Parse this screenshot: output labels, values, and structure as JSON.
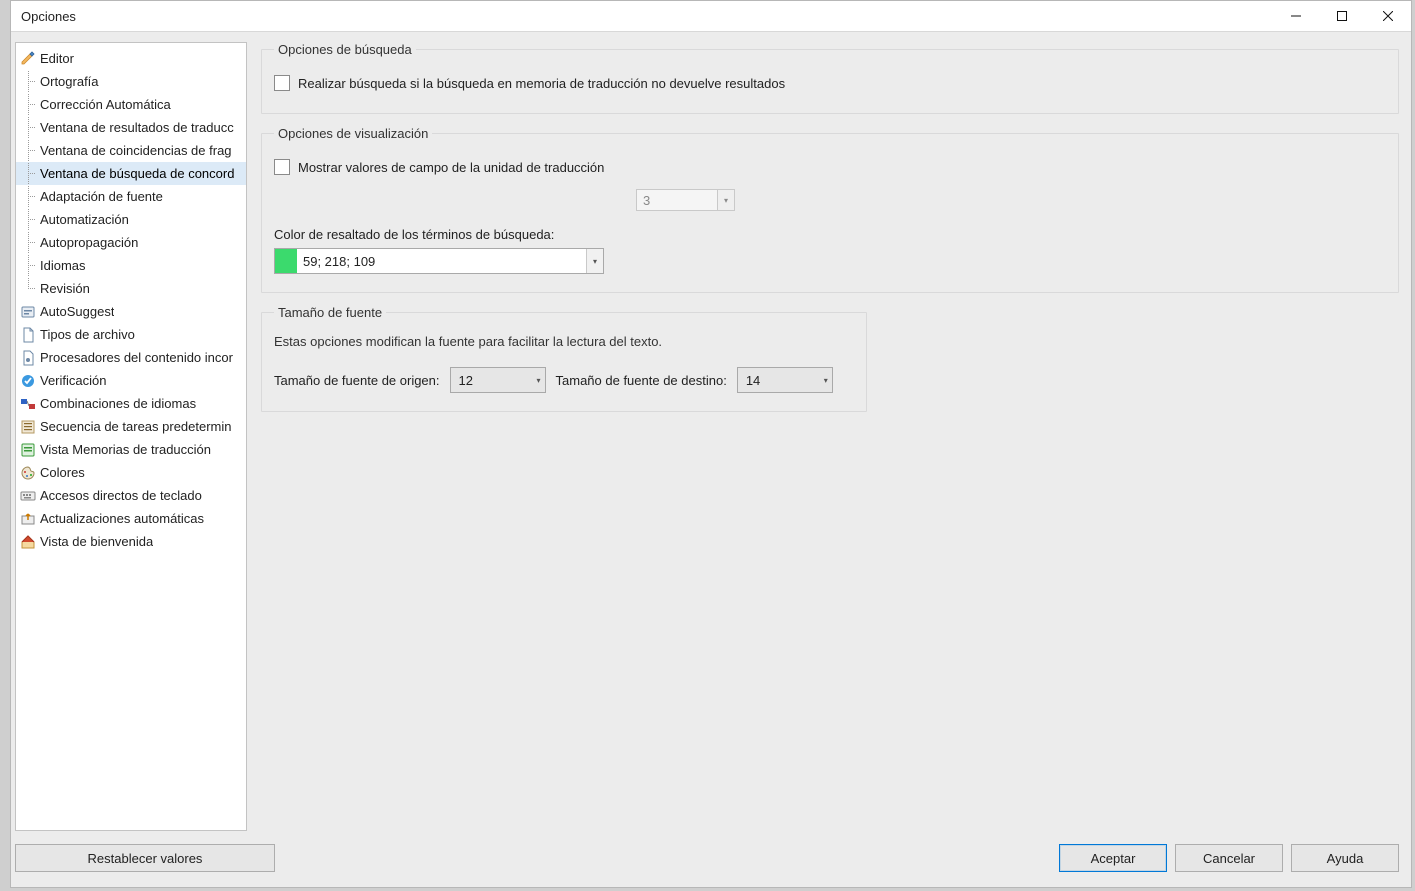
{
  "window": {
    "title": "Opciones"
  },
  "tree": {
    "editor": "Editor",
    "editor_children": [
      "Ortografía",
      "Corrección Automática",
      "Ventana de resultados de traducc",
      "Ventana de coincidencias de frag",
      "Ventana de búsqueda de concord",
      "Adaptación de fuente",
      "Automatización",
      "Autopropagación",
      "Idiomas",
      "Revisión"
    ],
    "selected_child_index": 4,
    "top_items": [
      "AutoSuggest",
      "Tipos de archivo",
      "Procesadores del contenido incor",
      "Verificación",
      "Combinaciones de idiomas",
      "Secuencia de tareas predetermin",
      "Vista Memorias de traducción",
      "Colores",
      "Accesos directos de teclado",
      "Actualizaciones automáticas",
      "Vista de bienvenida"
    ]
  },
  "groups": {
    "search": {
      "legend": "Opciones de búsqueda",
      "checkbox1": "Realizar búsqueda si la búsqueda en memoria de traducción no devuelve resultados"
    },
    "display": {
      "legend": "Opciones de visualización",
      "checkbox1": "Mostrar valores de campo de la unidad de traducción",
      "numeric_value": "3",
      "highlight_label": "Color de resaltado de los términos de búsqueda:",
      "highlight_value": "59; 218; 109",
      "highlight_hex": "#3bda6d"
    },
    "font": {
      "legend": "Tamaño de fuente",
      "desc": "Estas opciones modifican la fuente para facilitar la lectura del texto.",
      "src_label": "Tamaño de fuente de origen:",
      "src_value": "12",
      "tgt_label": "Tamaño de fuente de destino:",
      "tgt_value": "14"
    }
  },
  "footer": {
    "reset": "Restablecer valores",
    "ok": "Aceptar",
    "cancel": "Cancelar",
    "help": "Ayuda"
  }
}
